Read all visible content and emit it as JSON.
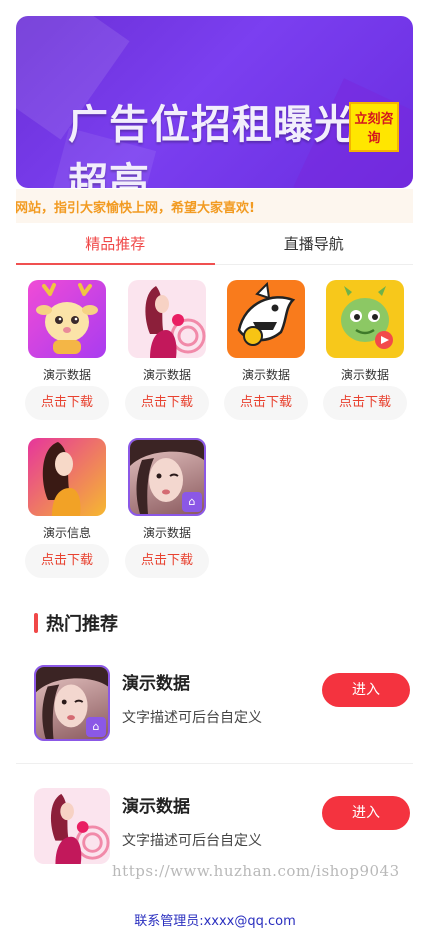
{
  "banner": {
    "title": "广告位招租曝光率超高",
    "badge": "立刻咨询"
  },
  "notice": {
    "text": "航网站，指引大家愉快上网，希望大家喜欢!"
  },
  "tabs": [
    {
      "label": "精品推荐",
      "active": true
    },
    {
      "label": "直播导航",
      "active": false
    }
  ],
  "apps": [
    {
      "name": "演示数据",
      "button": "点击下载",
      "icon": "deer-mascot-icon"
    },
    {
      "name": "演示数据",
      "button": "点击下载",
      "icon": "girl-pink-icon"
    },
    {
      "name": "演示数据",
      "button": "点击下载",
      "icon": "shark-icon"
    },
    {
      "name": "演示数据",
      "button": "点击下载",
      "icon": "dragon-icon"
    },
    {
      "name": "演示信息",
      "button": "点击下载",
      "icon": "girl-orange-icon"
    },
    {
      "name": "演示数据",
      "button": "点击下载",
      "icon": "photo-girl-icon"
    }
  ],
  "hot": {
    "title": "热门推荐",
    "items": [
      {
        "title": "演示数据",
        "desc": "文字描述可后台自定义",
        "button": "进入",
        "icon": "photo-girl-icon"
      },
      {
        "title": "演示数据",
        "desc": "文字描述可后台自定义",
        "button": "进入",
        "icon": "girl-pink-icon"
      }
    ]
  },
  "watermark": "https://www.huzhan.com/ishop9043",
  "footer": "联系管理员:xxxx@qq.com",
  "colors": {
    "accent": "#f04848",
    "button": "#f4333f",
    "notice": "#f29b22",
    "footer": "#2a2fbf"
  }
}
